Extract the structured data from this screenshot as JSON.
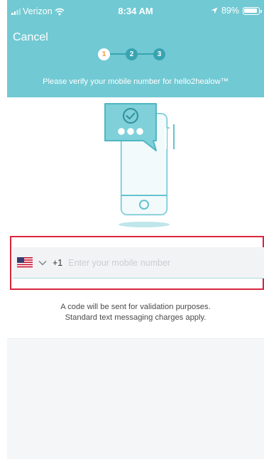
{
  "status_bar": {
    "carrier": "Verizon",
    "time": "8:34 AM",
    "battery": "89%",
    "battery_level": 0.89
  },
  "header": {
    "cancel_label": "Cancel",
    "steps": [
      "1",
      "2",
      "3"
    ],
    "active_step": 1,
    "instruction": "Please verify your mobile number for hello2healow™"
  },
  "phone_input": {
    "country_code": "+1",
    "placeholder": "Enter your mobile number",
    "value": ""
  },
  "note": {
    "line1": "A code will be sent for validation purposes.",
    "line2": "Standard text messaging charges apply."
  },
  "colors": {
    "header_bg": "#71c9d3",
    "step_inactive": "#39a4b1",
    "step_active_text": "#f39a32",
    "highlight_border": "#d9253d",
    "footer_bg": "#f5f6f8"
  },
  "icons": [
    "wifi-icon",
    "location-arrow-icon",
    "battery-icon",
    "us-flag-icon",
    "chevron-down-icon",
    "phone-message-illustration"
  ]
}
